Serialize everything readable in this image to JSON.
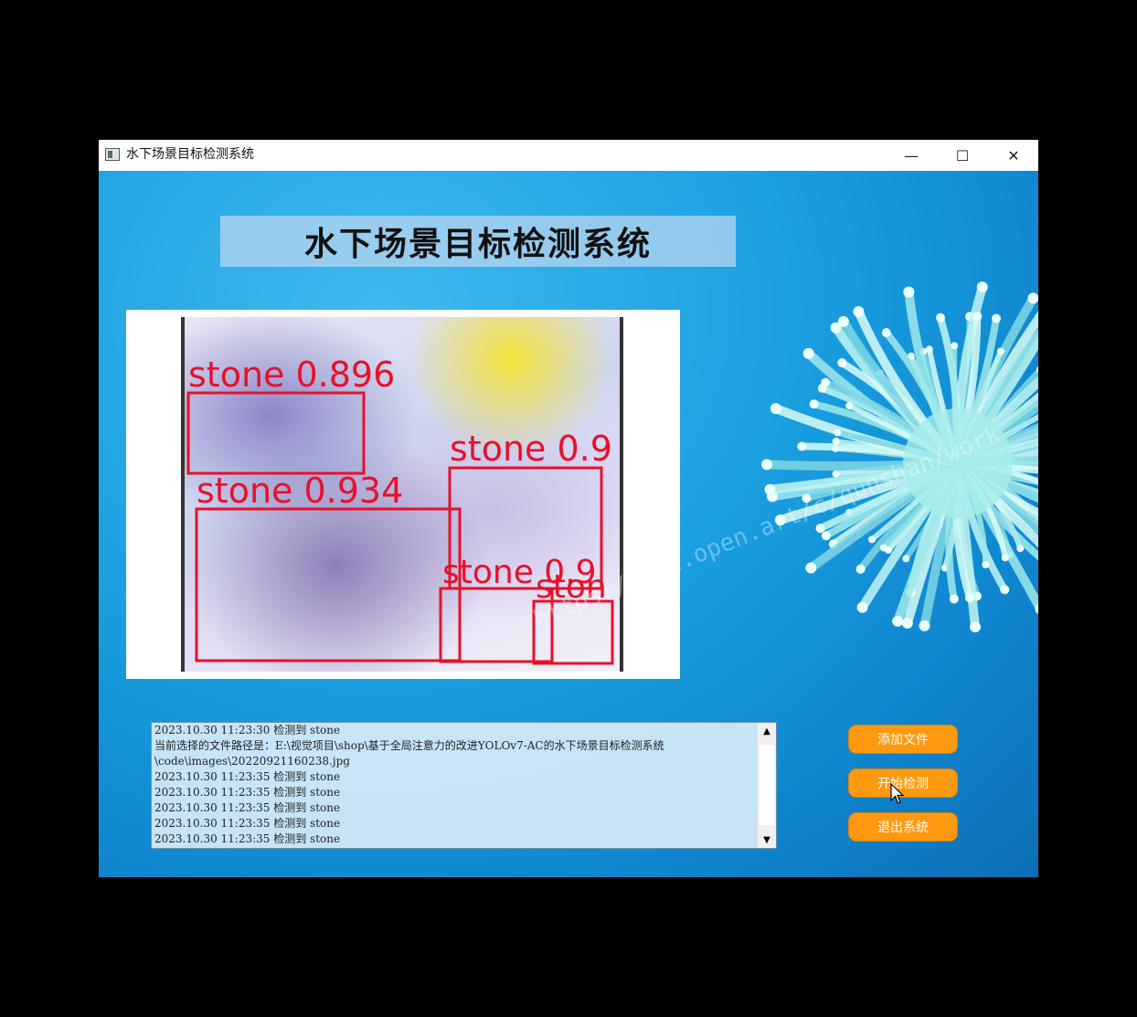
{
  "window": {
    "title": "水下场景目标检测系统",
    "controls": {
      "minimize": "—",
      "maximize": "☐",
      "close": "✕"
    }
  },
  "main": {
    "heading": "水下场景目标检测系统",
    "detections": [
      {
        "label": "stone 0.896"
      },
      {
        "label": "stone 0.934"
      },
      {
        "label": "stone 0.9"
      },
      {
        "label": "stone 0.9"
      },
      {
        "label": "ston"
      }
    ],
    "watermark": "https://mbd.open.art/c/qunshan/work"
  },
  "log": {
    "lines": [
      "2023.10.30 11:23:30  检测到 stone",
      "当前选择的文件路径是：E:\\视觉项目\\shop\\基于全局注意力的改进YOLOv7-AC的水下场景目标检测系统",
      "\\code\\images\\20220921160238.jpg",
      "2023.10.30 11:23:35  检测到 stone",
      "2023.10.30 11:23:35  检测到 stone",
      "2023.10.30 11:23:35  检测到 stone",
      "2023.10.30 11:23:35  检测到 stone",
      "2023.10.30 11:23:35  检测到 stone"
    ]
  },
  "buttons": {
    "add_file": "添加文件",
    "start_detect": "开始检测",
    "exit_system": "退出系统"
  },
  "colors": {
    "button": "#ff9a10",
    "box": "#e8102a",
    "background": "#1a9fe0"
  }
}
